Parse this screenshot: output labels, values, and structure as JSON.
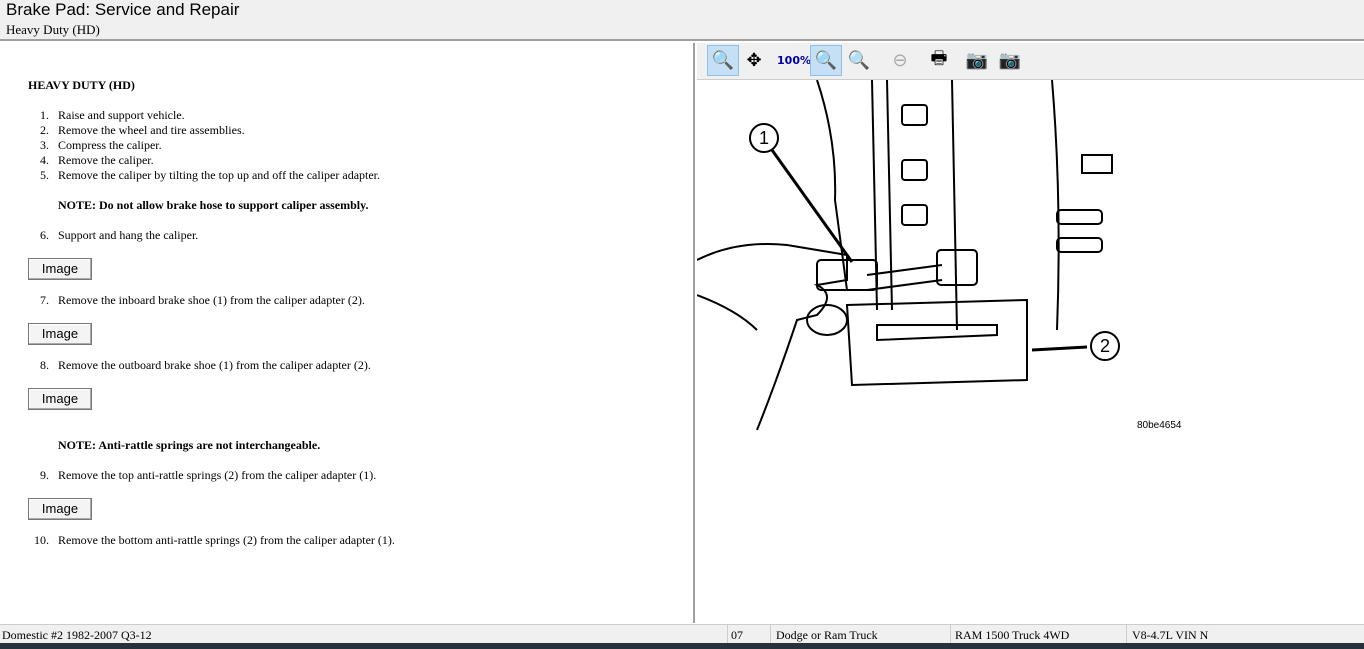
{
  "header": {
    "title": "Brake Pad:  Service and Repair",
    "subtitle": "Heavy Duty (HD)"
  },
  "content": {
    "heading": "HEAVY DUTY (HD)",
    "steps": [
      {
        "n": "1.",
        "t": "Raise and support vehicle."
      },
      {
        "n": "2.",
        "t": "Remove the wheel and tire assemblies."
      },
      {
        "n": "3.",
        "t": "Compress the caliper."
      },
      {
        "n": "4.",
        "t": "Remove the caliper."
      },
      {
        "n": "5.",
        "t": "Remove the caliper by tilting the top up and off the caliper adapter."
      },
      {
        "n": "6.",
        "t": "Support and hang the caliper."
      },
      {
        "n": "7.",
        "t": "Remove the inboard brake shoe (1) from the caliper adapter (2)."
      },
      {
        "n": "8.",
        "t": "Remove the outboard brake shoe (1) from the caliper adapter (2)."
      },
      {
        "n": "9.",
        "t": "Remove the top anti-rattle springs (2) from the caliper adapter (1)."
      },
      {
        "n": "10.",
        "t": "Remove the bottom anti-rattle springs (2) from the caliper adapter (1)."
      }
    ],
    "note1": "NOTE: Do not allow brake hose to support caliper assembly.",
    "note2": "NOTE: Anti-rattle springs are not interchangeable.",
    "image_button": "Image"
  },
  "toolbar": [
    "zoom-in",
    "pan",
    "zoom-100",
    "zoom-fit",
    "zoom-width",
    "zoom-out",
    "print",
    "prev-image",
    "next-image"
  ],
  "figure": {
    "callout1": "1",
    "callout2": "2",
    "code": "80be4654"
  },
  "status": {
    "db": "Domestic #2 1982-2007 Q3-12",
    "year": "07",
    "make": "Dodge or Ram Truck",
    "model": "RAM 1500 Truck 4WD",
    "engine": "V8-4.7L VIN N"
  }
}
